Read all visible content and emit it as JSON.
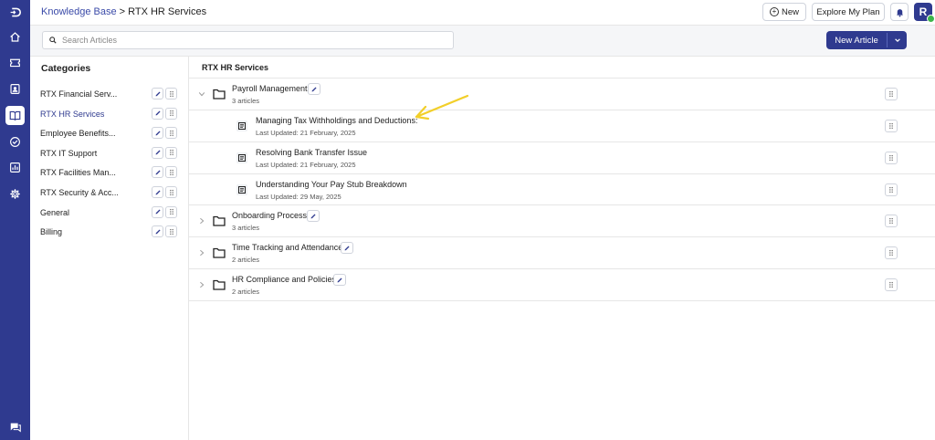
{
  "header": {
    "breadcrumb_root": "Knowledge Base",
    "breadcrumb_separator": ">",
    "breadcrumb_current": "RTX HR Services",
    "new_label": "New",
    "explore_plan_label": "Explore My Plan",
    "avatar_letter": "R"
  },
  "search": {
    "placeholder": "Search Articles"
  },
  "actions": {
    "new_article_label": "New Article"
  },
  "categories": {
    "title": "Categories",
    "items": [
      {
        "label": "RTX Financial Serv...",
        "active": false
      },
      {
        "label": "RTX HR Services",
        "active": true
      },
      {
        "label": "Employee Benefits...",
        "active": false
      },
      {
        "label": "RTX IT Support",
        "active": false
      },
      {
        "label": "RTX Facilities Man...",
        "active": false
      },
      {
        "label": "RTX Security & Acc...",
        "active": false
      },
      {
        "label": "General",
        "active": false
      },
      {
        "label": "Billing",
        "active": false
      }
    ]
  },
  "main": {
    "title": "RTX HR Services",
    "folders": [
      {
        "title": "Payroll Management",
        "count": "3 articles",
        "expanded": true,
        "articles": [
          {
            "title": "Managing Tax Withholdings and Deductions:",
            "updated": "Last Updated: 21 February, 2025"
          },
          {
            "title": "Resolving Bank Transfer Issue",
            "updated": "Last Updated: 21 February, 2025"
          },
          {
            "title": "Understanding Your Pay Stub Breakdown",
            "updated": "Last Updated: 29 May, 2025"
          }
        ]
      },
      {
        "title": "Onboarding Process",
        "count": "3 articles",
        "expanded": false
      },
      {
        "title": "Time Tracking and Attendance",
        "count": "2 articles",
        "expanded": false
      },
      {
        "title": "HR Compliance and Policies",
        "count": "2 articles",
        "expanded": false
      }
    ]
  },
  "colors": {
    "brand": "#2f3a8f",
    "annotation_arrow": "#f2cf2a",
    "online": "#3bb54a"
  },
  "icons": {
    "rail": [
      "logo-icon",
      "home-icon",
      "ticket-icon",
      "contacts-icon",
      "knowledge-base-icon",
      "tasks-icon",
      "reports-icon",
      "settings-icon",
      "chat-icon"
    ]
  }
}
